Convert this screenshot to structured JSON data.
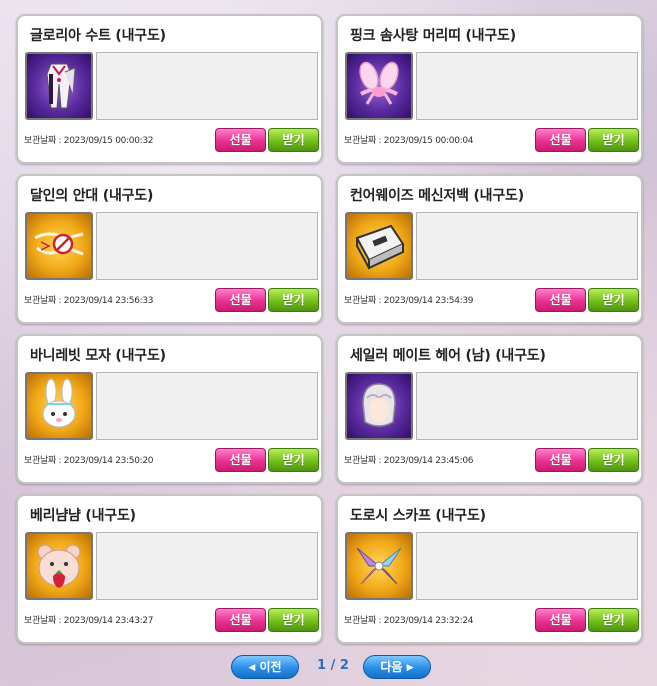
{
  "items": [
    {
      "name": "글로리아 수트 (내구도)",
      "date_label": "보관날짜 :",
      "date": "2023/09/15 00:00:32",
      "icon": "gloria-suit-icon"
    },
    {
      "name": "핑크 솜사탕 머리띠 (내구도)",
      "date_label": "보관날짜 :",
      "date": "2023/09/15 00:00:04",
      "icon": "pink-cotton-candy-headband-icon"
    },
    {
      "name": "달인의 안대 (내구도)",
      "date_label": "보관날짜 :",
      "date": "2023/09/14 23:56:33",
      "icon": "master-eyepatch-icon"
    },
    {
      "name": "컨어웨이즈 메신저백 (내구도)",
      "date_label": "보관날짜 :",
      "date": "2023/09/14 23:54:39",
      "icon": "messenger-bag-icon"
    },
    {
      "name": "바니레빗 모자 (내구도)",
      "date_label": "보관날짜 :",
      "date": "2023/09/14 23:50:20",
      "icon": "bunny-rabbit-hat-icon"
    },
    {
      "name": "세일러 메이트 헤어 (남) (내구도)",
      "date_label": "보관날짜 :",
      "date": "2023/09/14 23:45:06",
      "icon": "sailor-mate-hair-icon"
    },
    {
      "name": "베리냠냠 (내구도)",
      "date_label": "보관날짜 :",
      "date": "2023/09/14 23:43:27",
      "icon": "berry-nyamnyam-icon"
    },
    {
      "name": "도로시 스카프 (내구도)",
      "date_label": "보관날짜 :",
      "date": "2023/09/14 23:32:24",
      "icon": "dorothy-scarf-icon"
    }
  ],
  "buttons": {
    "gift": "선물",
    "receive": "받기"
  },
  "pagination": {
    "prev": "이전",
    "next": "다음",
    "current": "1",
    "separator": "/",
    "total": "2"
  },
  "colors": {
    "gift": "#e9318e",
    "receive": "#73bf1c",
    "pager": "#2a8de8"
  }
}
